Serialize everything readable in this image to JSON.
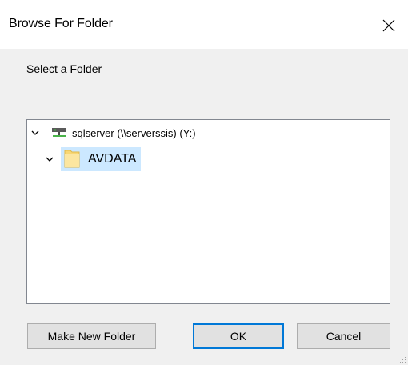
{
  "dialog": {
    "title": "Browse For Folder",
    "instruction": "Select a Folder"
  },
  "tree": {
    "root": {
      "label": "sqlserver (\\\\serverssis)  (Y:)",
      "icon": "network-drive-icon",
      "expanded": true
    },
    "child": {
      "label": "AVDATA",
      "icon": "folder-icon",
      "expanded": true,
      "selected": true
    }
  },
  "buttons": {
    "make_new_folder": "Make New Folder",
    "ok": "OK",
    "cancel": "Cancel"
  },
  "colors": {
    "selection": "#cce8ff",
    "default_button_border": "#0078d7",
    "folder": "#f8d775"
  }
}
